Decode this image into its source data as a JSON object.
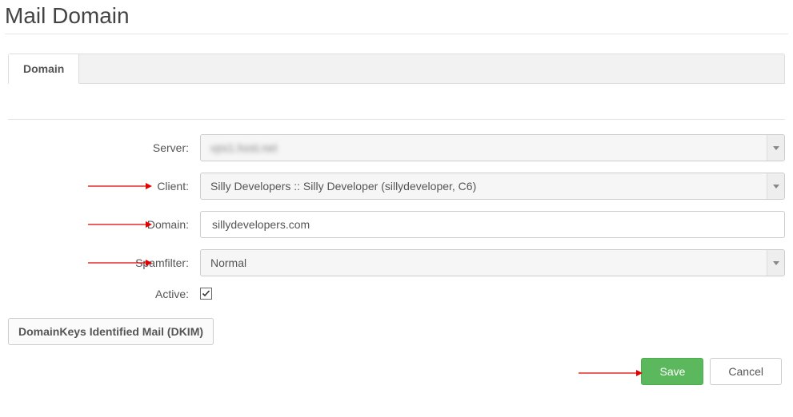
{
  "page": {
    "title": "Mail Domain"
  },
  "tabs": {
    "domain": "Domain"
  },
  "form": {
    "server": {
      "label": "Server:",
      "value": "vps1.host.net"
    },
    "client": {
      "label": "Client:",
      "value": "Silly Developers :: Silly Developer (sillydeveloper, C6)"
    },
    "domain": {
      "label": "Domain:",
      "value": "sillydevelopers.com"
    },
    "spam": {
      "label": "Spamfilter:",
      "value": "Normal"
    },
    "active": {
      "label": "Active:",
      "checked": true
    }
  },
  "dkim_button": "DomainKeys Identified Mail (DKIM)",
  "buttons": {
    "save": "Save",
    "cancel": "Cancel"
  }
}
